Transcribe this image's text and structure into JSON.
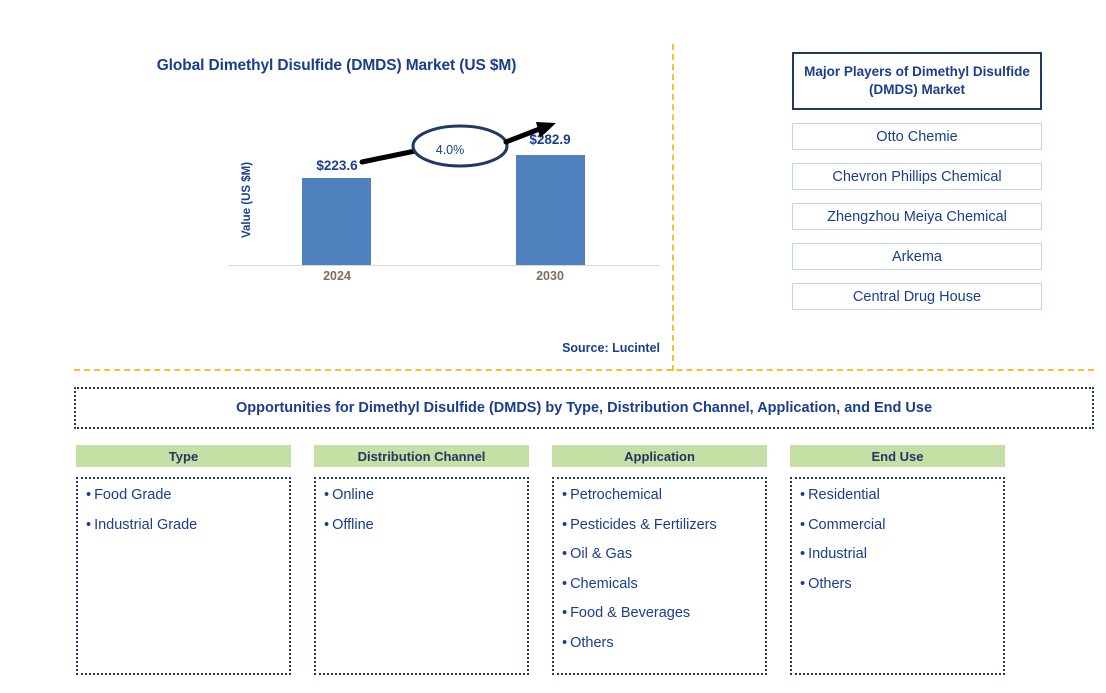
{
  "chart_data": {
    "type": "bar",
    "title": "Global Dimethyl Disulfide (DMDS) Market (US $M)",
    "xlabel": "",
    "ylabel": "Value (US $M)",
    "categories": [
      "2024",
      "2030"
    ],
    "values": [
      223.6,
      282.9
    ],
    "value_labels": [
      "$223.6",
      "$282.9"
    ],
    "cagr_label": "4.0%",
    "grid": false,
    "legend": false,
    "ylim": [
      0,
      300
    ],
    "bar_color": "#4e81bd",
    "source": "Source: Lucintel"
  },
  "players": {
    "title": "Major Players of Dimethyl Disulfide (DMDS) Market",
    "items": [
      {
        "label": "Otto Chemie"
      },
      {
        "label": "Chevron Phillips Chemical"
      },
      {
        "label": "Zhengzhou Meiya Chemical"
      },
      {
        "label": "Arkema"
      },
      {
        "label": "Central Drug House"
      }
    ]
  },
  "opportunities": {
    "banner": "Opportunities for Dimethyl Disulfide (DMDS) by Type, Distribution Channel, Application, and End Use",
    "columns": [
      {
        "header": "Type",
        "items": [
          "Food Grade",
          "Industrial Grade"
        ]
      },
      {
        "header": "Distribution Channel",
        "items": [
          "Online",
          "Offline"
        ]
      },
      {
        "header": "Application",
        "items": [
          "Petrochemical",
          "Pesticides & Fertilizers",
          "Oil & Gas",
          "Chemicals",
          "Food & Beverages",
          "Others"
        ]
      },
      {
        "header": "End Use",
        "items": [
          "Residential",
          "Commercial",
          "Industrial",
          "Others"
        ]
      }
    ]
  },
  "theme": {
    "navy": "#1a3d8f",
    "bar_blue": "#4e81bd",
    "green_header": "#c5e0a5",
    "divider_amber": "#fcbf2e",
    "tick_brown": "#7f6e5d"
  },
  "bullet": "•"
}
